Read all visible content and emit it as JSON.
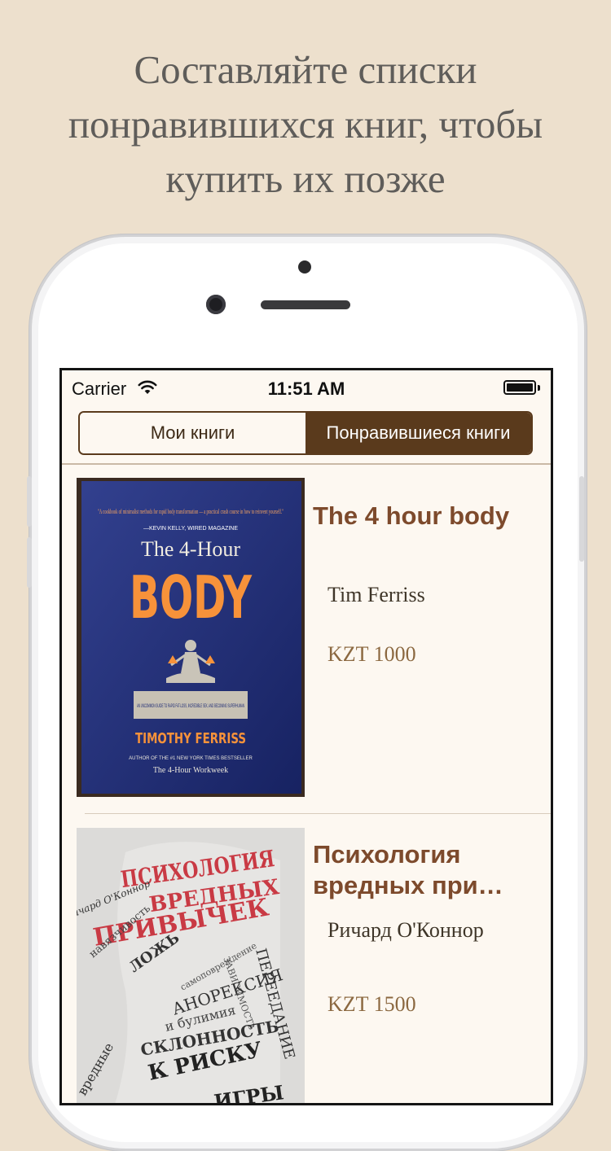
{
  "headline": "Составляйте списки\nпонравившихся книг, чтобы\nкупить их позже",
  "status_bar": {
    "carrier": "Carrier",
    "time": "11:51 AM",
    "battery_level": 1.0
  },
  "tabs": [
    {
      "label": "Мои книги",
      "selected": false
    },
    {
      "label": "Понравившиеся книги",
      "selected": true
    }
  ],
  "books": [
    {
      "title": "The 4 hour body",
      "author": "Tim Ferriss",
      "price": "KZT 1000",
      "cover": {
        "blurb": "\"A cookbook of minimalist methods for rapid body transformation — a practical crash course in how to reinvent yourself.\"",
        "blurb_source": "—KEVIN KELLY, WIRED MAGAZINE",
        "title_line1": "The 4-Hour",
        "title_line2": "BODY",
        "subtitle": "AN UNCOMMON GUIDE TO RAPID FAT-LOSS, INCREDIBLE SEX, AND BECOMING SUPERHUMAN",
        "author": "TIMOTHY FERRISS",
        "author_note": "AUTHOR OF THE #1 NEW YORK TIMES BESTSELLER",
        "previous_book": "The 4-Hour Workweek"
      }
    },
    {
      "title": "Психология вредных при…",
      "author": "Ричард О'Коннор",
      "price": "KZT 1500",
      "cover": {
        "title_line1": "ПСИХОЛОГИЯ",
        "title_line2": "ВРЕДНЫХ",
        "title_line3": "ПРИВЫЧЕК",
        "author": "Ричард О'Коннор",
        "words": [
          "ПЕРЕЕДАНИЕ",
          "ЗАВИСИМОСТЬ",
          "АНОРЕКСИЯ",
          "и булимия",
          "СКЛОННОСТЬ",
          "К РИСКУ",
          "ЛОЖЬ",
          "самоповреждение",
          "навязчивость",
          "вредные",
          "ИГРЫ"
        ]
      }
    }
  ],
  "colors": {
    "background": "#ede0cd",
    "accent": "#5a3a1c",
    "title": "#7d4a2c",
    "price": "#8b6840"
  },
  "icons": [
    "wifi-icon",
    "battery-icon"
  ]
}
